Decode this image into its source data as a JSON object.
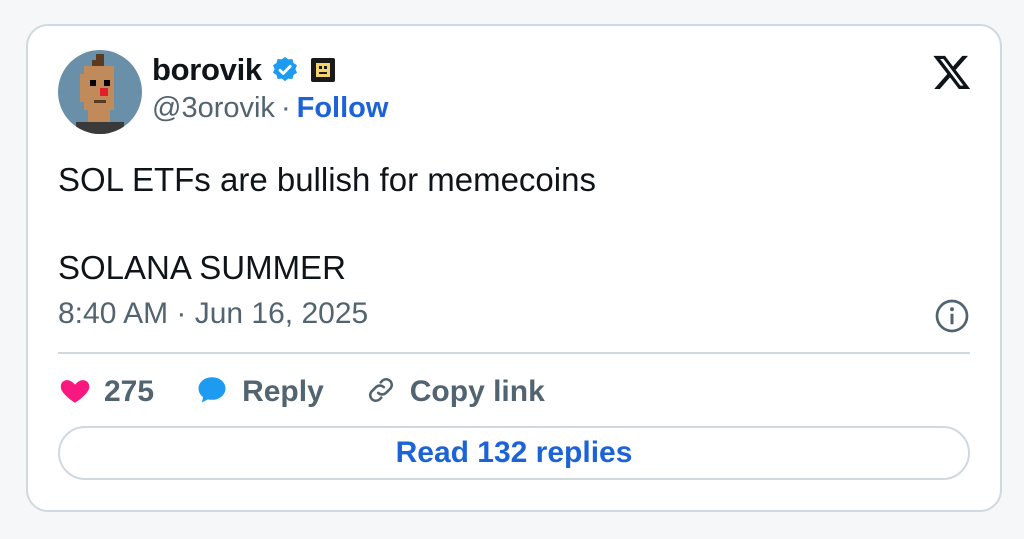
{
  "author": {
    "name": "borovik",
    "handle": "@3orovik",
    "separator": "·",
    "follow_label": "Follow",
    "verified_icon": "verified-badge-icon",
    "affiliate_icon": "affiliate-badge-icon",
    "avatar": "pixel-art-avatar"
  },
  "tweet": {
    "line1": "SOL ETFs are bullish for memecoins",
    "line2": "SOLANA SUMMER",
    "timestamp": "8:40 AM · Jun 16, 2025"
  },
  "actions": {
    "like_count": "275",
    "reply_label": "Reply",
    "copy_link_label": "Copy link"
  },
  "read_replies_label": "Read 132 replies",
  "colors": {
    "accent": "#1d63d8",
    "like": "#f91880",
    "muted": "#536471",
    "border": "#cfd9de"
  }
}
